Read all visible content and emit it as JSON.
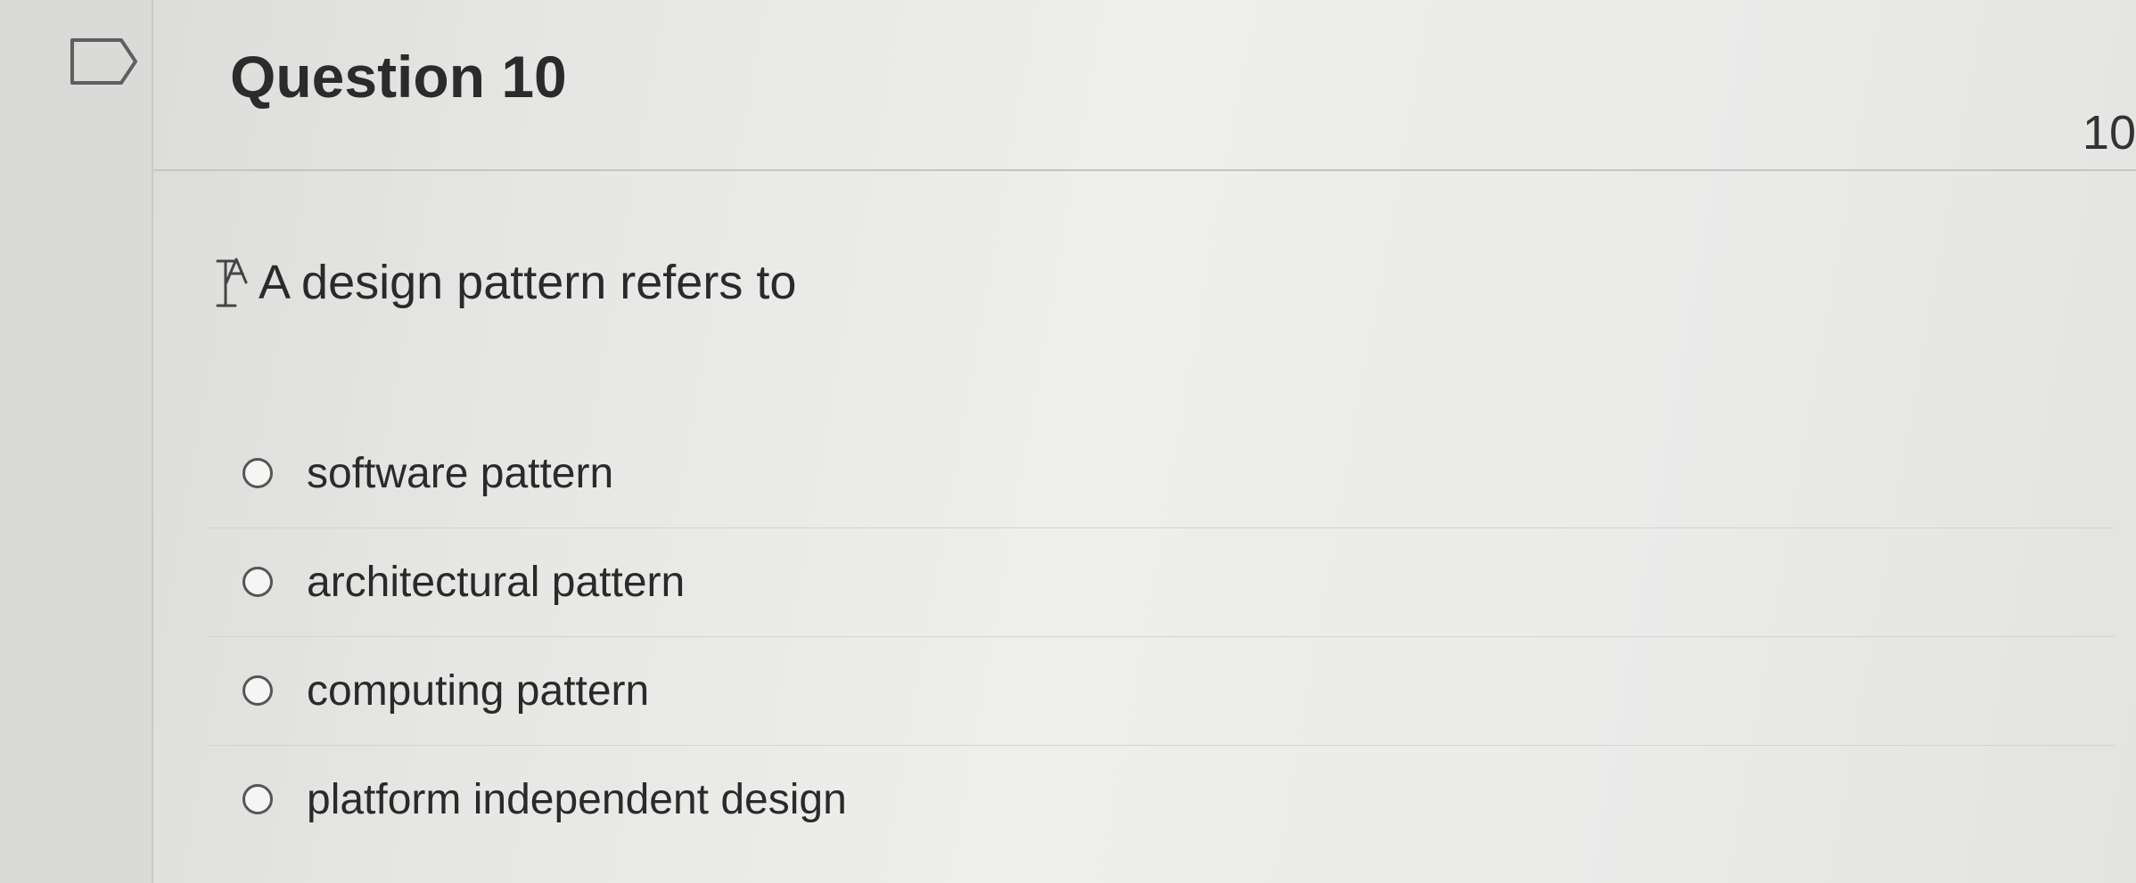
{
  "question": {
    "title": "Question 10",
    "points": "10",
    "text": "A design pattern refers to"
  },
  "answers": [
    {
      "label": "software pattern"
    },
    {
      "label": "architectural pattern"
    },
    {
      "label": "computing pattern"
    },
    {
      "label": "platform independent design"
    }
  ],
  "colors": {
    "background": "#e6e6e4",
    "text": "#2a2a2a",
    "divider": "#c4c4c2"
  },
  "icons": {
    "flag": "flag-icon",
    "accessibility": "accessibility-icon"
  }
}
